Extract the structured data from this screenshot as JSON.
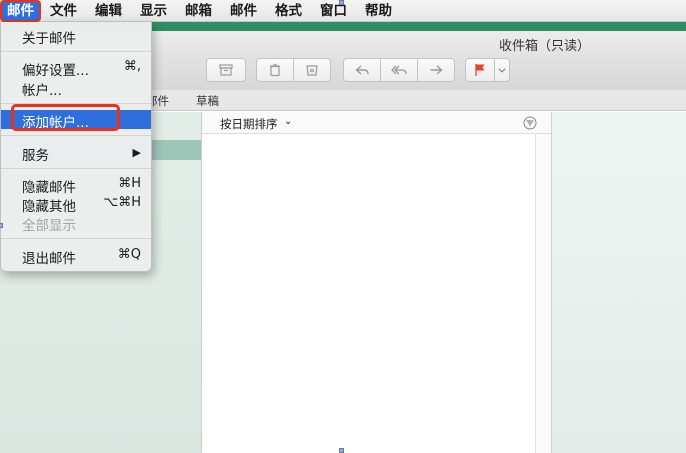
{
  "menubar": {
    "items": [
      "邮件",
      "文件",
      "编辑",
      "显示",
      "邮箱",
      "邮件",
      "格式",
      "窗口",
      "帮助"
    ]
  },
  "window": {
    "title": "收件箱（只读）"
  },
  "favorites": {
    "items": [
      "邮件",
      "草稿"
    ]
  },
  "message_list": {
    "sort_label": "按日期排序"
  },
  "mail_menu": {
    "about": "关于邮件",
    "preferences": "偏好设置...",
    "preferences_shortcut": "⌘,",
    "accounts": "帐户...",
    "add_account": "添加帐户...",
    "services": "服务",
    "services_arrow": "▶",
    "hide_mail": "隐藏邮件",
    "hide_mail_shortcut": "⌘H",
    "hide_others": "隐藏其他",
    "hide_others_shortcut": "⌥⌘H",
    "show_all": "全部显示",
    "quit": "退出邮件",
    "quit_shortcut": "⌘Q"
  },
  "colors": {
    "accent": "#2f6fdd",
    "highlight_outline": "#e8331c",
    "window_band": "#2f8d63",
    "sidebar_selection": "#9fc5b9",
    "flag": "#e8402e"
  }
}
